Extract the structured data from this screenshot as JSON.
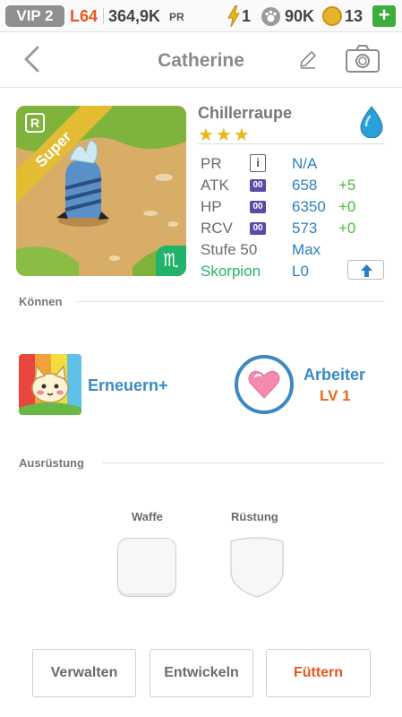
{
  "statusbar": {
    "vip": "VIP 2",
    "level": "L64",
    "power": "364,9K",
    "power_unit": "PR",
    "energy": "1",
    "paws": "90K",
    "coins": "13",
    "plus": "+"
  },
  "header": {
    "title": "Catherine"
  },
  "pet": {
    "name": "Chillerraupe",
    "stars": "★★★",
    "rarity": "R",
    "grade": "Super",
    "zodiac_symbol": "♏",
    "stats": {
      "pr_label": "PR",
      "pr_value": "N/A",
      "info": "i",
      "atk_label": "ATK",
      "atk_value": "658",
      "atk_bonus": "+5",
      "hp_label": "HP",
      "hp_value": "6350",
      "hp_bonus": "+0",
      "rcv_label": "RCV",
      "rcv_value": "573",
      "rcv_bonus": "+0",
      "stufe_label": "Stufe 50",
      "stufe_value": "Max",
      "zodiac_label": "Skorpion",
      "zodiac_value": "L0",
      "badge": "00"
    }
  },
  "skills": {
    "section": "Können",
    "skill_name": "Erneuern+",
    "worker_title": "Arbeiter",
    "worker_level": "LV 1"
  },
  "equipment": {
    "section": "Ausrüstung",
    "weapon": "Waffe",
    "armor": "Rüstung"
  },
  "actions": {
    "manage": "Verwalten",
    "evolve": "Entwickeln",
    "feed": "Füttern"
  },
  "colors": {
    "accent_orange": "#e8561c",
    "accent_blue": "#3b8ac4",
    "accent_green": "#4bbb3a",
    "zodiac_green": "#22b36b"
  }
}
